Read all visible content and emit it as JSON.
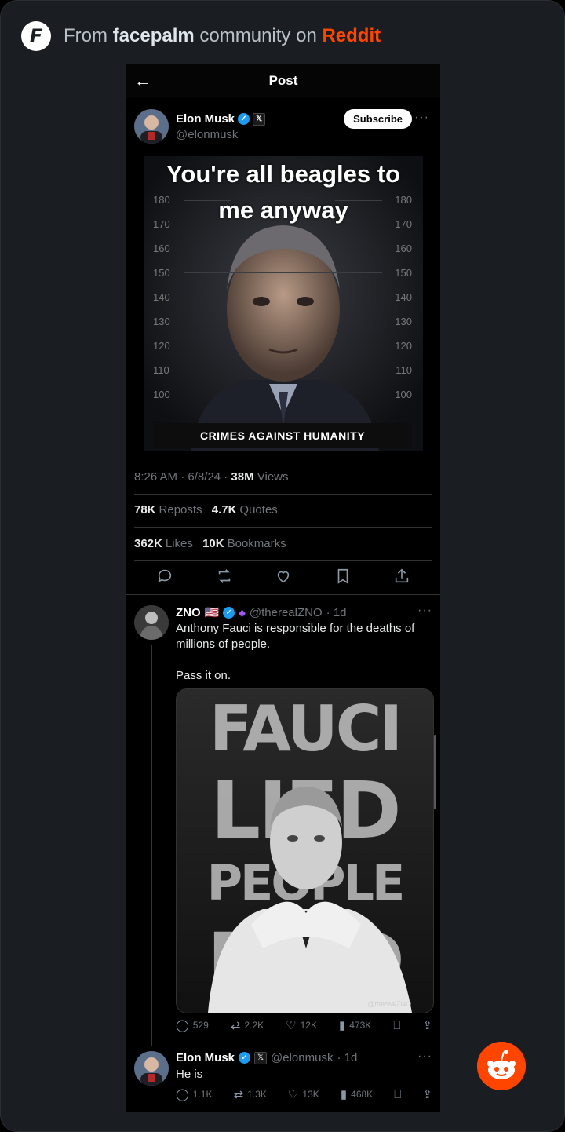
{
  "header": {
    "logo_letter": "F",
    "prefix": "From ",
    "community": "facepalm",
    "middle": " community on ",
    "platform": "Reddit"
  },
  "post": {
    "topbar_title": "Post",
    "author_name": "Elon Musk",
    "author_handle": "@elonmusk",
    "subscribe_label": "Subscribe",
    "meme_line1": "You're all beagles to",
    "meme_line2": "me anyway",
    "ruler_left": [
      "180",
      "170",
      "160",
      "150",
      "140",
      "130",
      "120",
      "110",
      "100"
    ],
    "ruler_right": [
      "180",
      "170",
      "160",
      "150",
      "140",
      "130",
      "120",
      "110",
      "100"
    ],
    "image_caption": "CRIMES AGAINST HUMANITY",
    "time": "8:26 AM · 6/8/24 · ",
    "views_count": "38M",
    "views_label": " Views",
    "reposts_count": "78K",
    "reposts_label": "Reposts",
    "quotes_count": "4.7K",
    "quotes_label": "Quotes",
    "likes_count": "362K",
    "likes_label": "Likes",
    "bookmarks_count": "10K",
    "bookmarks_label": "Bookmarks"
  },
  "reply1": {
    "name": "ZNO",
    "flag": "🇺🇸",
    "handle": "@therealZNO",
    "time": "· 1d",
    "text": "Anthony Fauci is responsible for the deaths of millions of people.\n\nPass it on.",
    "image_words": [
      "FAUCI",
      "LIED",
      "PEOPLE",
      "DIED"
    ],
    "watermark": "@therealZNO",
    "replies": "529",
    "reposts": "2.2K",
    "likes": "12K",
    "views": "473K"
  },
  "reply2": {
    "name": "Elon Musk",
    "handle": "@elonmusk",
    "time": "· 1d",
    "text": "He is",
    "replies": "1.1K",
    "reposts": "1.3K",
    "likes": "13K",
    "views": "468K"
  },
  "colors": {
    "reddit_orange": "#ff4500",
    "verified_blue": "#1d9bf0"
  }
}
